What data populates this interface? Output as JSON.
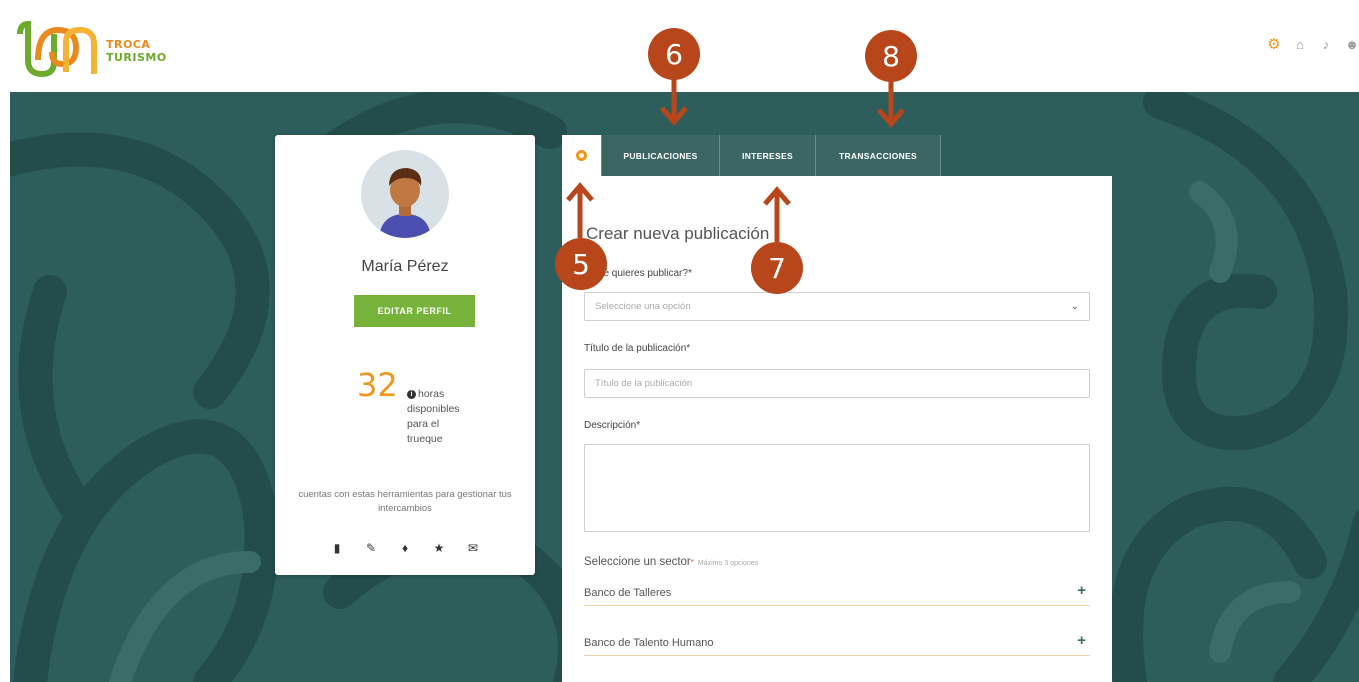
{
  "brand": {
    "line1": "TROCA",
    "line2": "TURISMO"
  },
  "top_icons": [
    "gear-icon",
    "home-icon",
    "bell-icon",
    "user-icon"
  ],
  "profile": {
    "name": "María Pérez",
    "edit_button": "EDITAR PERFIL",
    "hours_count": "32",
    "hours_label": "horas disponibles para el trueque",
    "tools_text": "cuentas con estas herramientas para gestionar tus intercambios",
    "tool_icons": [
      "mobile-icon",
      "edit-icon",
      "bell-icon",
      "star-icon",
      "mail-icon"
    ]
  },
  "tabs": [
    {
      "label": "",
      "icon": "gear-icon",
      "active": true
    },
    {
      "label": "PUBLICACIONES",
      "active": false
    },
    {
      "label": "INTERESES",
      "active": false
    },
    {
      "label": "TRANSACCIONES",
      "active": false
    }
  ],
  "form": {
    "title": "Crear nueva publicación",
    "type_label": "¿Qué quieres publicar?*",
    "type_placeholder": "Seleccione una opción",
    "title_label": "Título de la publicación*",
    "title_placeholder": "Título de la publicación",
    "desc_label": "Descripción*",
    "sector_label": "Seleccione un sector",
    "sector_hint": "Máximo 3 opciones",
    "sectors": [
      "Banco de Talleres",
      "Banco de Talento Humano"
    ]
  },
  "callouts": [
    "5",
    "6",
    "7",
    "8"
  ],
  "colors": {
    "accent_orange": "#f0961f",
    "brand_green": "#77b33a",
    "background_teal": "#2d5e5c",
    "callout": "#b8461b"
  }
}
